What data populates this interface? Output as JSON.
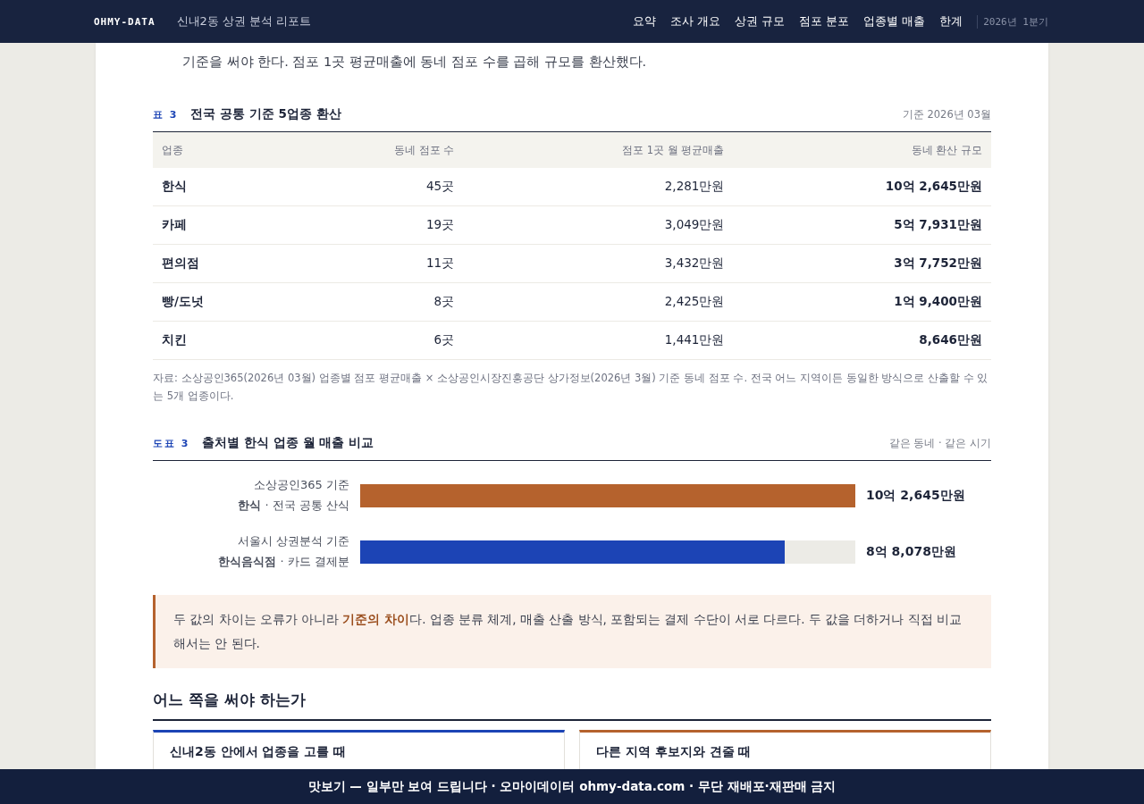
{
  "header": {
    "brand": "OHMY-DATA",
    "title": "신내2동 상권 분석 리포트",
    "nav": [
      {
        "label": "요약",
        "selected": false
      },
      {
        "label": "조사 개요",
        "selected": false
      },
      {
        "label": "상권 규모",
        "selected": false
      },
      {
        "label": "점포 분포",
        "selected": false
      },
      {
        "label": "업종별 매출",
        "selected": false
      },
      {
        "label": "한계",
        "selected": false
      }
    ],
    "period": "2026년 1분기"
  },
  "intro_tail": "기준을 써야 한다. 점포 1곳 평균매출에 동네 점포 수를 곱해 규모를 환산했다.",
  "table": {
    "tag": "표 3",
    "title": "전국 공통 기준 5업종 환산",
    "note": "기준 2026년 03월",
    "columns": [
      "업종",
      "동네 점포 수",
      "점포 1곳 월 평균매출",
      "동네 환산 규모"
    ],
    "rows": [
      [
        "한식",
        "45곳",
        "2,281만원",
        "10억 2,645만원"
      ],
      [
        "카페",
        "19곳",
        "3,049만원",
        "5억 7,931만원"
      ],
      [
        "편의점",
        "11곳",
        "3,432만원",
        "3억 7,752만원"
      ],
      [
        "빵/도넛",
        "8곳",
        "2,425만원",
        "1억 9,400만원"
      ],
      [
        "치킨",
        "6곳",
        "1,441만원",
        "8,646만원"
      ]
    ],
    "source": "자료: 소상공인365(2026년 03월) 업종별 점포 평균매출 × 소상공인시장진흥공단 상가정보(2026년 3월) 기준 동네 점포 수. 전국 어느 지역이든 동일한 방식으로 산출할 수 있는 5개 업종이다."
  },
  "figure": {
    "tag": "도표 3",
    "title": "출처별 한식 업종 월 매출 비교",
    "note": "같은 동네 · 같은 시기",
    "bars": [
      {
        "label": "소상공인365 기준",
        "note": "**한식** · 전국 공통 산식",
        "level": 1,
        "reading": "10억 2,645만원",
        "color": "#b5622d"
      },
      {
        "label": "서울시 상권분석 기준",
        "note": "**한식음식점** · 카드 결제분",
        "level": 0.858,
        "reading": "8억 8,078만원",
        "color": "#1c44b5"
      }
    ]
  },
  "callout": "두 값의 차이는 오류가 아니라 **기준의 차이**다. 업종 분류 체계, 매출 산출 방식, 포함되는 결제 수단이 서로 다르다. 두 값을 더하거나 직접 비교해서는 안 된다.",
  "section_title": "어느 쪽을 써야 하는가",
  "cards": [
    {
      "title": "신내2동 안에서 업종을 고를 때",
      "color": "#1c44b5"
    },
    {
      "title": "다른 지역 후보지와 견줄 때",
      "color": "#b5622d"
    }
  ],
  "footer": "맛보기 — 일부만 보여 드립니다 · 오마이데이터 ohmy-data.com · 무단 재배포·재판매 금지"
}
